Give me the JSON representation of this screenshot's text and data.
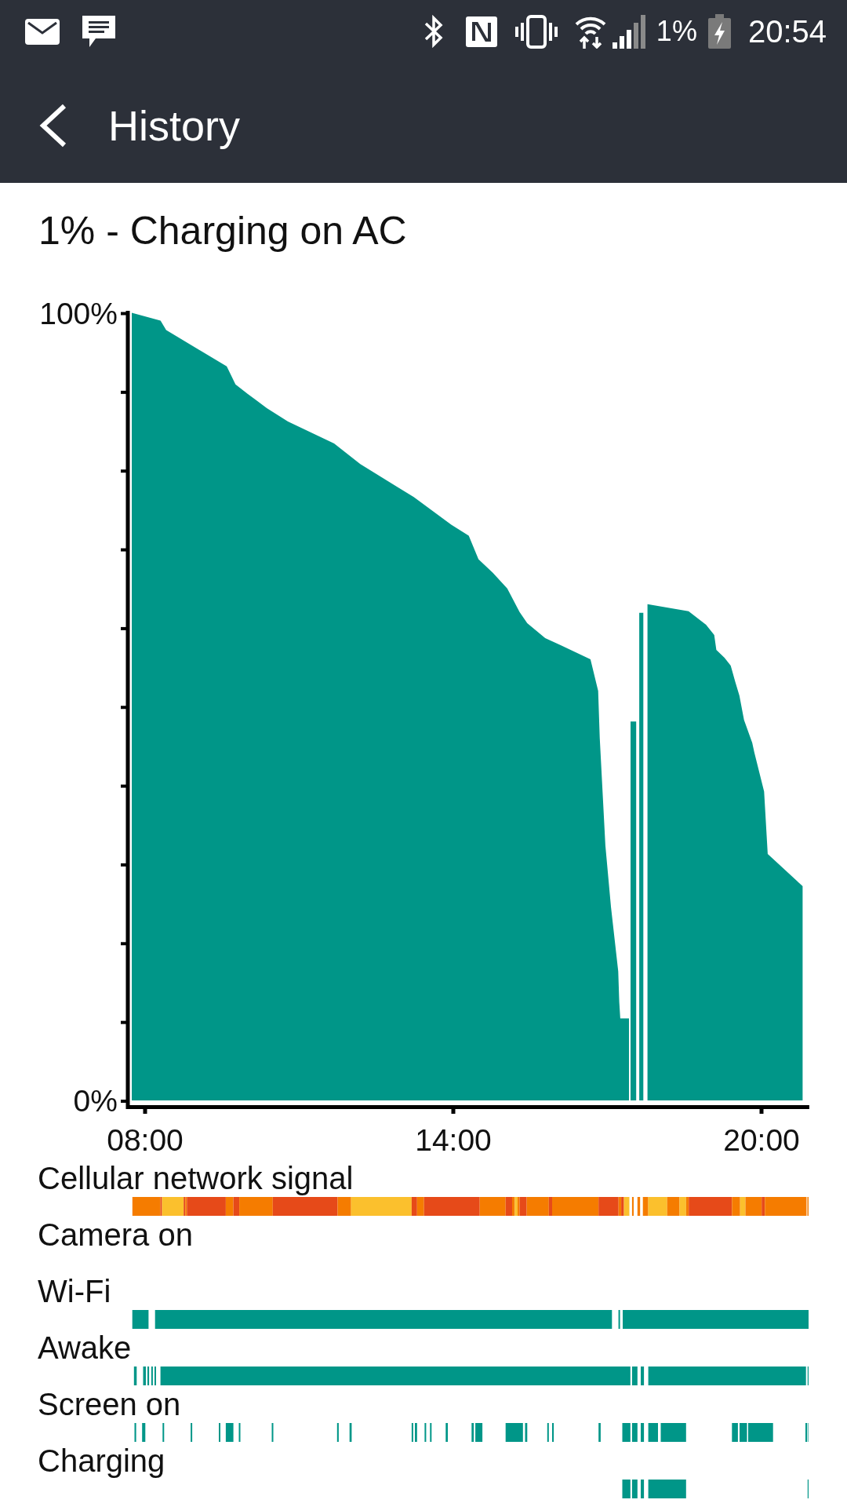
{
  "status_bar": {
    "battery": "1%",
    "time": "20:54"
  },
  "app_bar": {
    "title": "History"
  },
  "summary": "1% - Charging on AC",
  "chart": {
    "chart_data": {
      "type": "area",
      "x": [
        7.74,
        8.3,
        8.41,
        9.59,
        9.76,
        10.0,
        10.37,
        10.78,
        11.68,
        12.19,
        13.23,
        13.96,
        14.3,
        14.49,
        14.77,
        15.05,
        15.29,
        15.44,
        15.79,
        16.09,
        16.67,
        16.82,
        16.85,
        16.96,
        17.07,
        17.21,
        17.23,
        17.25,
        17.42,
        17.44,
        17.45,
        17.56,
        17.59,
        17.62,
        17.7,
        17.74,
        17.78,
        18.58,
        18.92,
        19.08,
        19.12,
        19.28,
        19.4,
        19.49,
        19.57,
        19.66,
        19.82,
        19.86,
        20.05,
        20.12,
        20.8
      ],
      "series": [
        {
          "color": "#009688",
          "values": [
            100,
            99,
            97.8,
            93.2,
            90.9,
            89.7,
            87.9,
            86.2,
            83.4,
            80.8,
            76.6,
            73.1,
            71.7,
            68.7,
            67,
            65,
            62,
            60.6,
            58.7,
            57.8,
            56,
            52,
            46.1,
            32.4,
            24.5,
            16.4,
            12.5,
            10.4,
            10.4,
            null,
            48.1,
            48.1,
            null,
            61.9,
            61.9,
            null,
            63,
            62.1,
            60.4,
            59.1,
            57.2,
            56.2,
            55.2,
            53.1,
            51.4,
            48.3,
            45.4,
            44.2,
            39.2,
            31.3,
            27.2
          ]
        }
      ],
      "xlim": [
        7.664,
        20.93
      ],
      "ylim": [
        0,
        100
      ],
      "xticks": [
        {
          "value": 8,
          "label": "08:00"
        },
        {
          "value": 14,
          "label": "14:00"
        },
        {
          "value": 20,
          "label": "20:00"
        }
      ],
      "yticks": [
        {
          "value": 0,
          "label": "0%"
        },
        {
          "value": 100,
          "label": "100%"
        }
      ]
    }
  },
  "timelines": [
    {
      "label": "Cellular network signal",
      "kind": "signal"
    },
    {
      "label": "Camera on",
      "kind": "camera"
    },
    {
      "label": "Wi-Fi",
      "kind": "wifi"
    },
    {
      "label": "Awake",
      "kind": "awake"
    },
    {
      "label": "Screen on",
      "kind": "screen"
    },
    {
      "label": "Charging",
      "kind": "charging"
    }
  ]
}
